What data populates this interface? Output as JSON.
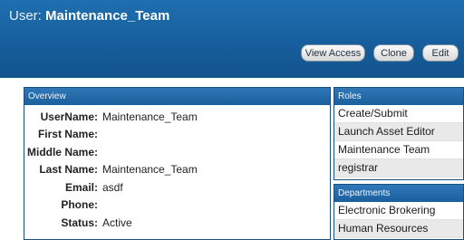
{
  "header": {
    "prefix": "User:",
    "name": "Maintenance_Team"
  },
  "toolbar": {
    "view_access": "View Access",
    "clone": "Clone",
    "edit": "Edit"
  },
  "overview": {
    "title": "Overview",
    "rows": [
      {
        "label": "UserName:",
        "value": "Maintenance_Team"
      },
      {
        "label": "First Name:",
        "value": ""
      },
      {
        "label": "Middle Name:",
        "value": ""
      },
      {
        "label": "Last Name:",
        "value": "Maintenance_Team"
      },
      {
        "label": "Email:",
        "value": "asdf"
      },
      {
        "label": "Phone:",
        "value": ""
      },
      {
        "label": "Status:",
        "value": "Active"
      }
    ]
  },
  "roles": {
    "title": "Roles",
    "items": [
      "Create/Submit",
      "Launch Asset Editor",
      "Maintenance Team",
      "registrar"
    ]
  },
  "departments": {
    "title": "Departments",
    "items": [
      "Electronic Brokering",
      "Human Resources"
    ]
  },
  "colors": {
    "header_blue": "#165e9c",
    "panel_header_blue": "#2f78b8"
  }
}
